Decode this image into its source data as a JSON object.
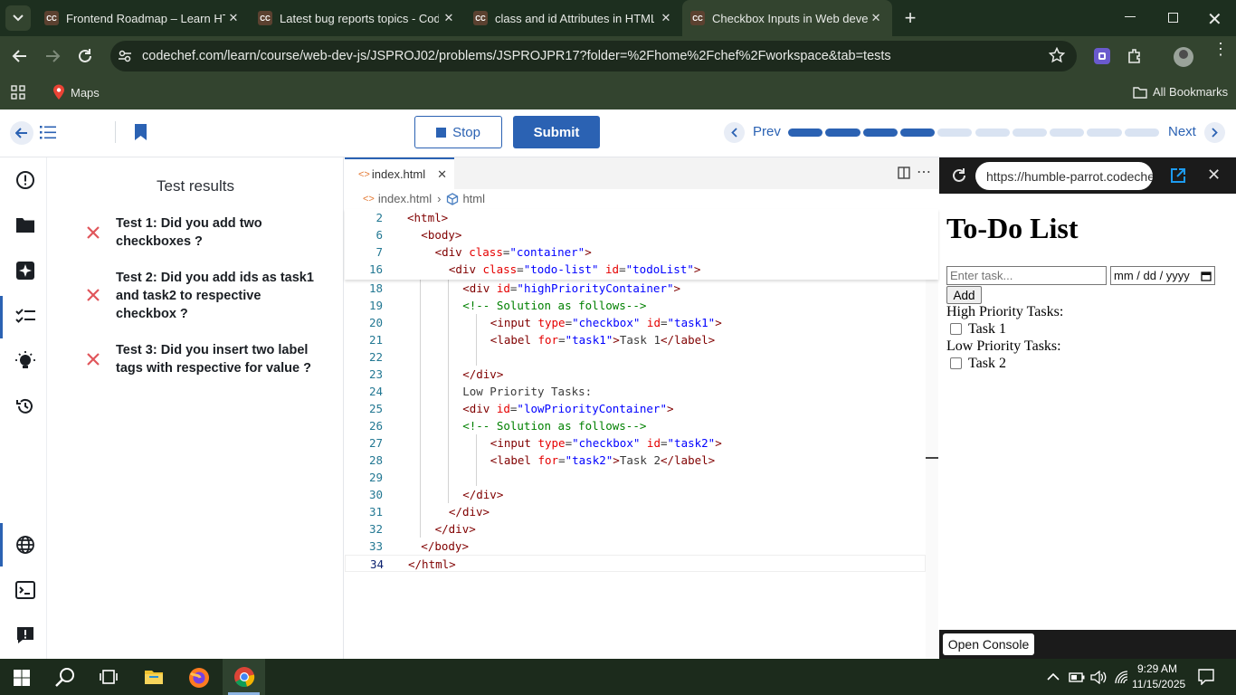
{
  "browser": {
    "tabs": [
      {
        "favicon": "CC",
        "title": "Frontend Roadmap – Learn HTML",
        "active": false
      },
      {
        "favicon": "CC",
        "title": "Latest bug reports topics - CodeChef",
        "active": false
      },
      {
        "favicon": "CC",
        "title": "class and id Attributes in HTML",
        "active": false
      },
      {
        "favicon": "CC",
        "title": "Checkbox Inputs in Web development",
        "active": true
      }
    ],
    "url": "codechef.com/learn/course/web-dev-js/JSPROJ02/problems/JSPROJPR17?folder=%2Fhome%2Fchef%2Fworkspace&tab=tests",
    "bookmarks": {
      "maps": "Maps",
      "all": "All Bookmarks"
    }
  },
  "app_header": {
    "stop_label": "Stop",
    "submit_label": "Submit",
    "prev_label": "Prev",
    "next_label": "Next",
    "progress_filled": 4,
    "progress_total": 10,
    "accent": "#2b62b3"
  },
  "results": {
    "title": "Test results",
    "tests": [
      {
        "status": "failed",
        "text": "Test 1: Did you add two checkboxes ?"
      },
      {
        "status": "failed",
        "text": "Test 2: Did you add ids as task1 and task2 to respective checkbox ?"
      },
      {
        "status": "failed",
        "text": "Test 3: Did you insert two label tags with respective for value ?"
      }
    ]
  },
  "editor": {
    "tab_label": "index.html",
    "breadcrumb_file": "index.html",
    "breadcrumb_symbol": "html",
    "sticky_lines": [
      {
        "n": "2",
        "indent": 0,
        "html": "<span class='t'>&lt;html&gt;</span>"
      },
      {
        "n": "6",
        "indent": 1,
        "html": "<span class='t'>&lt;body&gt;</span>"
      },
      {
        "n": "7",
        "indent": 2,
        "html": "<span class='t'>&lt;div</span> <span class='a'>class</span><span class='p'>=</span><span class='s'>\"container\"</span><span class='t'>&gt;</span>"
      },
      {
        "n": "16",
        "indent": 3,
        "html": "<span class='t'>&lt;div</span> <span class='a'>class</span><span class='p'>=</span><span class='s'>\"todo-list\"</span> <span class='a'>id</span><span class='p'>=</span><span class='s'>\"todoList\"</span><span class='t'>&gt;</span>"
      }
    ],
    "lines": [
      {
        "n": "18",
        "indent": 4,
        "html": "<span class='t'>&lt;div</span> <span class='a'>id</span><span class='p'>=</span><span class='s'>\"highPriorityContainer\"</span><span class='t'>&gt;</span>"
      },
      {
        "n": "19",
        "indent": 4,
        "html": "<span class='c'>&lt;!-- Solution as follows--&gt;</span>"
      },
      {
        "n": "20",
        "indent": 6,
        "html": "<span class='t'>&lt;input</span> <span class='a'>type</span><span class='p'>=</span><span class='s'>\"checkbox\"</span> <span class='a'>id</span><span class='p'>=</span><span class='s'>\"task1\"</span><span class='t'>&gt;</span>"
      },
      {
        "n": "21",
        "indent": 6,
        "html": "<span class='t'>&lt;label</span> <span class='a'>for</span><span class='p'>=</span><span class='s'>\"task1\"</span><span class='t'>&gt;</span><span class='p'>Task 1</span><span class='t'>&lt;/label&gt;</span>"
      },
      {
        "n": "22",
        "indent": 6,
        "html": ""
      },
      {
        "n": "23",
        "indent": 4,
        "html": "<span class='t'>&lt;/div&gt;</span>"
      },
      {
        "n": "24",
        "indent": 4,
        "html": "<span class='p'>Low Priority Tasks:</span>"
      },
      {
        "n": "25",
        "indent": 4,
        "html": "<span class='t'>&lt;div</span> <span class='a'>id</span><span class='p'>=</span><span class='s'>\"lowPriorityContainer\"</span><span class='t'>&gt;</span>"
      },
      {
        "n": "26",
        "indent": 4,
        "html": "<span class='c'>&lt;!-- Solution as follows--&gt;</span>"
      },
      {
        "n": "27",
        "indent": 6,
        "html": "<span class='t'>&lt;input</span> <span class='a'>type</span><span class='p'>=</span><span class='s'>\"checkbox\"</span> <span class='a'>id</span><span class='p'>=</span><span class='s'>\"task2\"</span><span class='t'>&gt;</span>"
      },
      {
        "n": "28",
        "indent": 6,
        "html": "<span class='t'>&lt;label</span> <span class='a'>for</span><span class='p'>=</span><span class='s'>\"task2\"</span><span class='t'>&gt;</span><span class='p'>Task 2</span><span class='t'>&lt;/label&gt;</span>"
      },
      {
        "n": "29",
        "indent": 6,
        "html": ""
      },
      {
        "n": "30",
        "indent": 4,
        "html": "<span class='t'>&lt;/div&gt;</span>"
      },
      {
        "n": "31",
        "indent": 3,
        "html": "<span class='t'>&lt;/div&gt;</span>"
      },
      {
        "n": "32",
        "indent": 2,
        "html": "<span class='t'>&lt;/div&gt;</span>"
      },
      {
        "n": "33",
        "indent": 1,
        "html": "<span class='t'>&lt;/body&gt;</span>"
      },
      {
        "n": "34",
        "indent": 0,
        "html": "<span class='t'>&lt;/html&gt;</span>"
      }
    ]
  },
  "preview": {
    "url": "https://humble-parrot.codechef",
    "heading": "To-Do List",
    "task_placeholder": "Enter task...",
    "date_placeholder": "mm / dd / yyyy",
    "add_label": "Add",
    "high_label": "High Priority Tasks:",
    "task1_label": "Task 1",
    "low_label": "Low Priority Tasks:",
    "task2_label": "Task 2",
    "console_label": "Open Console"
  },
  "taskbar": {
    "time": "9:29 AM",
    "date": "11/15/2025"
  }
}
